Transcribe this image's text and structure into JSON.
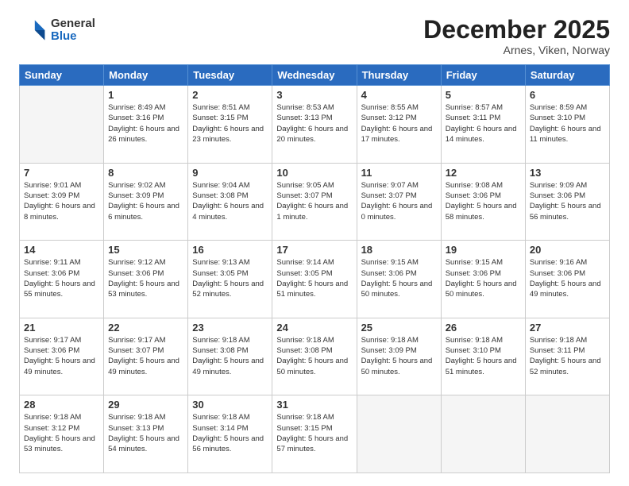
{
  "logo": {
    "general": "General",
    "blue": "Blue"
  },
  "header": {
    "month": "December 2025",
    "location": "Arnes, Viken, Norway"
  },
  "days": [
    "Sunday",
    "Monday",
    "Tuesday",
    "Wednesday",
    "Thursday",
    "Friday",
    "Saturday"
  ],
  "weeks": [
    [
      {
        "num": "",
        "empty": true
      },
      {
        "num": "1",
        "sunrise": "8:49 AM",
        "sunset": "3:16 PM",
        "daylight": "6 hours and 26 minutes."
      },
      {
        "num": "2",
        "sunrise": "8:51 AM",
        "sunset": "3:15 PM",
        "daylight": "6 hours and 23 minutes."
      },
      {
        "num": "3",
        "sunrise": "8:53 AM",
        "sunset": "3:13 PM",
        "daylight": "6 hours and 20 minutes."
      },
      {
        "num": "4",
        "sunrise": "8:55 AM",
        "sunset": "3:12 PM",
        "daylight": "6 hours and 17 minutes."
      },
      {
        "num": "5",
        "sunrise": "8:57 AM",
        "sunset": "3:11 PM",
        "daylight": "6 hours and 14 minutes."
      },
      {
        "num": "6",
        "sunrise": "8:59 AM",
        "sunset": "3:10 PM",
        "daylight": "6 hours and 11 minutes."
      }
    ],
    [
      {
        "num": "7",
        "sunrise": "9:01 AM",
        "sunset": "3:09 PM",
        "daylight": "6 hours and 8 minutes."
      },
      {
        "num": "8",
        "sunrise": "9:02 AM",
        "sunset": "3:09 PM",
        "daylight": "6 hours and 6 minutes."
      },
      {
        "num": "9",
        "sunrise": "9:04 AM",
        "sunset": "3:08 PM",
        "daylight": "6 hours and 4 minutes."
      },
      {
        "num": "10",
        "sunrise": "9:05 AM",
        "sunset": "3:07 PM",
        "daylight": "6 hours and 1 minute."
      },
      {
        "num": "11",
        "sunrise": "9:07 AM",
        "sunset": "3:07 PM",
        "daylight": "6 hours and 0 minutes."
      },
      {
        "num": "12",
        "sunrise": "9:08 AM",
        "sunset": "3:06 PM",
        "daylight": "5 hours and 58 minutes."
      },
      {
        "num": "13",
        "sunrise": "9:09 AM",
        "sunset": "3:06 PM",
        "daylight": "5 hours and 56 minutes."
      }
    ],
    [
      {
        "num": "14",
        "sunrise": "9:11 AM",
        "sunset": "3:06 PM",
        "daylight": "5 hours and 55 minutes."
      },
      {
        "num": "15",
        "sunrise": "9:12 AM",
        "sunset": "3:06 PM",
        "daylight": "5 hours and 53 minutes."
      },
      {
        "num": "16",
        "sunrise": "9:13 AM",
        "sunset": "3:05 PM",
        "daylight": "5 hours and 52 minutes."
      },
      {
        "num": "17",
        "sunrise": "9:14 AM",
        "sunset": "3:05 PM",
        "daylight": "5 hours and 51 minutes."
      },
      {
        "num": "18",
        "sunrise": "9:15 AM",
        "sunset": "3:06 PM",
        "daylight": "5 hours and 50 minutes."
      },
      {
        "num": "19",
        "sunrise": "9:15 AM",
        "sunset": "3:06 PM",
        "daylight": "5 hours and 50 minutes."
      },
      {
        "num": "20",
        "sunrise": "9:16 AM",
        "sunset": "3:06 PM",
        "daylight": "5 hours and 49 minutes."
      }
    ],
    [
      {
        "num": "21",
        "sunrise": "9:17 AM",
        "sunset": "3:06 PM",
        "daylight": "5 hours and 49 minutes."
      },
      {
        "num": "22",
        "sunrise": "9:17 AM",
        "sunset": "3:07 PM",
        "daylight": "5 hours and 49 minutes."
      },
      {
        "num": "23",
        "sunrise": "9:18 AM",
        "sunset": "3:08 PM",
        "daylight": "5 hours and 49 minutes."
      },
      {
        "num": "24",
        "sunrise": "9:18 AM",
        "sunset": "3:08 PM",
        "daylight": "5 hours and 50 minutes."
      },
      {
        "num": "25",
        "sunrise": "9:18 AM",
        "sunset": "3:09 PM",
        "daylight": "5 hours and 50 minutes."
      },
      {
        "num": "26",
        "sunrise": "9:18 AM",
        "sunset": "3:10 PM",
        "daylight": "5 hours and 51 minutes."
      },
      {
        "num": "27",
        "sunrise": "9:18 AM",
        "sunset": "3:11 PM",
        "daylight": "5 hours and 52 minutes."
      }
    ],
    [
      {
        "num": "28",
        "sunrise": "9:18 AM",
        "sunset": "3:12 PM",
        "daylight": "5 hours and 53 minutes."
      },
      {
        "num": "29",
        "sunrise": "9:18 AM",
        "sunset": "3:13 PM",
        "daylight": "5 hours and 54 minutes."
      },
      {
        "num": "30",
        "sunrise": "9:18 AM",
        "sunset": "3:14 PM",
        "daylight": "5 hours and 56 minutes."
      },
      {
        "num": "31",
        "sunrise": "9:18 AM",
        "sunset": "3:15 PM",
        "daylight": "5 hours and 57 minutes."
      },
      {
        "num": "",
        "empty": true
      },
      {
        "num": "",
        "empty": true
      },
      {
        "num": "",
        "empty": true
      }
    ]
  ]
}
